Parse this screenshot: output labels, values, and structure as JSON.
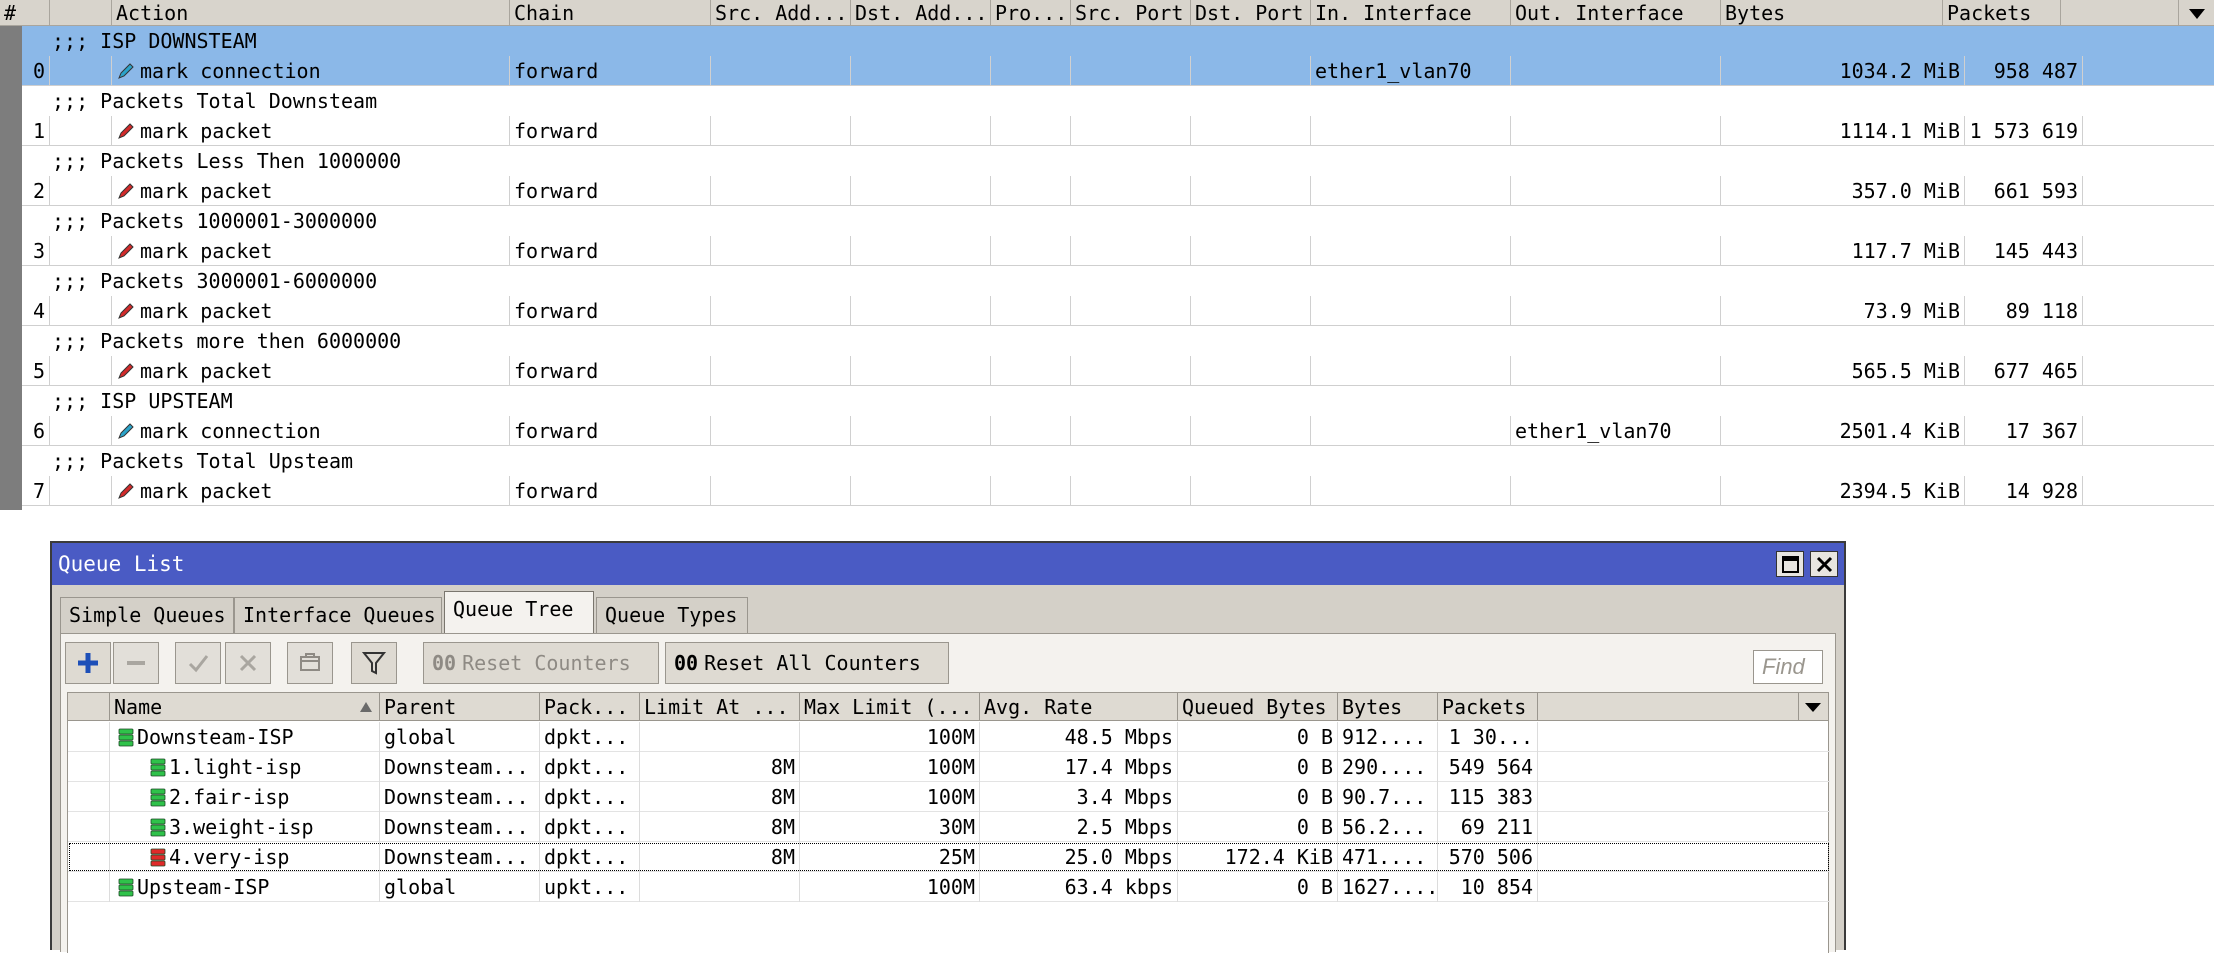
{
  "mangle": {
    "columns": [
      "#",
      "Action",
      "Chain",
      "Src. Add...",
      "Dst. Add...",
      "Pro...",
      "Src. Port",
      "Dst. Port",
      "In. Interface",
      "Out. Interface",
      "Bytes",
      "Packets"
    ],
    "rows": [
      {
        "kind": "comment",
        "text": ";;; ISP DOWNSTEAM",
        "selected": true
      },
      {
        "kind": "rule",
        "num": "0",
        "icon": "mark-connection-icon",
        "action": "mark connection",
        "chain": "forward",
        "in": "ether1_vlan70",
        "out": "",
        "bytes": "1034.2 MiB",
        "packets": "958 487",
        "selected": true
      },
      {
        "kind": "comment",
        "text": ";;; Packets Total Downsteam"
      },
      {
        "kind": "rule",
        "num": "1",
        "icon": "mark-packet-icon",
        "action": "mark packet",
        "chain": "forward",
        "in": "",
        "out": "",
        "bytes": "1114.1 MiB",
        "packets": "1 573 619"
      },
      {
        "kind": "comment",
        "text": ";;; Packets Less Then 1000000"
      },
      {
        "kind": "rule",
        "num": "2",
        "icon": "mark-packet-icon",
        "action": "mark packet",
        "chain": "forward",
        "in": "",
        "out": "",
        "bytes": "357.0 MiB",
        "packets": "661 593"
      },
      {
        "kind": "comment",
        "text": ";;; Packets 1000001-3000000"
      },
      {
        "kind": "rule",
        "num": "3",
        "icon": "mark-packet-icon",
        "action": "mark packet",
        "chain": "forward",
        "in": "",
        "out": "",
        "bytes": "117.7 MiB",
        "packets": "145 443"
      },
      {
        "kind": "comment",
        "text": ";;; Packets 3000001-6000000"
      },
      {
        "kind": "rule",
        "num": "4",
        "icon": "mark-packet-icon",
        "action": "mark packet",
        "chain": "forward",
        "in": "",
        "out": "",
        "bytes": "73.9 MiB",
        "packets": "89 118"
      },
      {
        "kind": "comment",
        "text": ";;; Packets more then 6000000"
      },
      {
        "kind": "rule",
        "num": "5",
        "icon": "mark-packet-icon",
        "action": "mark packet",
        "chain": "forward",
        "in": "",
        "out": "",
        "bytes": "565.5 MiB",
        "packets": "677 465"
      },
      {
        "kind": "comment",
        "text": ";;; ISP UPSTEAM"
      },
      {
        "kind": "rule",
        "num": "6",
        "icon": "mark-connection-icon",
        "action": "mark connection",
        "chain": "forward",
        "in": "",
        "out": "ether1_vlan70",
        "bytes": "2501.4 KiB",
        "packets": "17 367"
      },
      {
        "kind": "comment",
        "text": ";;; Packets Total Upsteam"
      },
      {
        "kind": "rule",
        "num": "7",
        "icon": "mark-packet-icon",
        "action": "mark packet",
        "chain": "forward",
        "in": "",
        "out": "",
        "bytes": "2394.5 KiB",
        "packets": "14 928"
      }
    ]
  },
  "queue_window": {
    "title": "Queue List",
    "tabs": [
      {
        "label": "Simple Queues"
      },
      {
        "label": "Interface Queues"
      },
      {
        "label": "Queue Tree",
        "active": true
      },
      {
        "label": "Queue Types"
      }
    ],
    "toolbar": {
      "reset_counters_prefix": "00",
      "reset_counters": "Reset Counters",
      "reset_all_prefix": "00",
      "reset_all": "Reset All Counters",
      "find_placeholder": "Find"
    },
    "columns": [
      "Name",
      "Parent",
      "Pack...",
      "Limit At ...",
      "Max Limit (...",
      "Avg. Rate",
      "Queued Bytes",
      "Bytes",
      "Packets"
    ],
    "rows": [
      {
        "indent": 0,
        "status": "green",
        "name": "Downsteam-ISP",
        "parent": "global",
        "packet_mark": "dpkt...",
        "limit_at": "",
        "max_limit": "100M",
        "avg_rate": "48.5 Mbps",
        "queued": "0 B",
        "bytes": "912....",
        "packets": "1 30..."
      },
      {
        "indent": 1,
        "status": "green",
        "name": "1.light-isp",
        "parent": "Downsteam...",
        "packet_mark": "dpkt...",
        "limit_at": "8M",
        "max_limit": "100M",
        "avg_rate": "17.4 Mbps",
        "queued": "0 B",
        "bytes": "290....",
        "packets": "549 564"
      },
      {
        "indent": 1,
        "status": "green",
        "name": "2.fair-isp",
        "parent": "Downsteam...",
        "packet_mark": "dpkt...",
        "limit_at": "8M",
        "max_limit": "100M",
        "avg_rate": "3.4 Mbps",
        "queued": "0 B",
        "bytes": "90.7...",
        "packets": "115 383"
      },
      {
        "indent": 1,
        "status": "green",
        "name": "3.weight-isp",
        "parent": "Downsteam...",
        "packet_mark": "dpkt...",
        "limit_at": "8M",
        "max_limit": "30M",
        "avg_rate": "2.5 Mbps",
        "queued": "0 B",
        "bytes": "56.2...",
        "packets": "69 211"
      },
      {
        "indent": 1,
        "status": "red",
        "name": "4.very-isp",
        "parent": "Downsteam...",
        "packet_mark": "dpkt...",
        "limit_at": "8M",
        "max_limit": "25M",
        "avg_rate": "25.0 Mbps",
        "queued": "172.4 KiB",
        "bytes": "471....",
        "packets": "570 506",
        "focused": true
      },
      {
        "indent": 0,
        "status": "green",
        "name": "Upsteam-ISP",
        "parent": "global",
        "packet_mark": "upkt...",
        "limit_at": "",
        "max_limit": "100M",
        "avg_rate": "63.4 kbps",
        "queued": "0 B",
        "bytes": "1627....",
        "packets": "10 854"
      }
    ]
  },
  "colors": {
    "selection": "#8bb8e8",
    "title_bar": "#4a5bc4",
    "queue_ok": "#2fc24a",
    "queue_limited": "#e02a2a"
  }
}
